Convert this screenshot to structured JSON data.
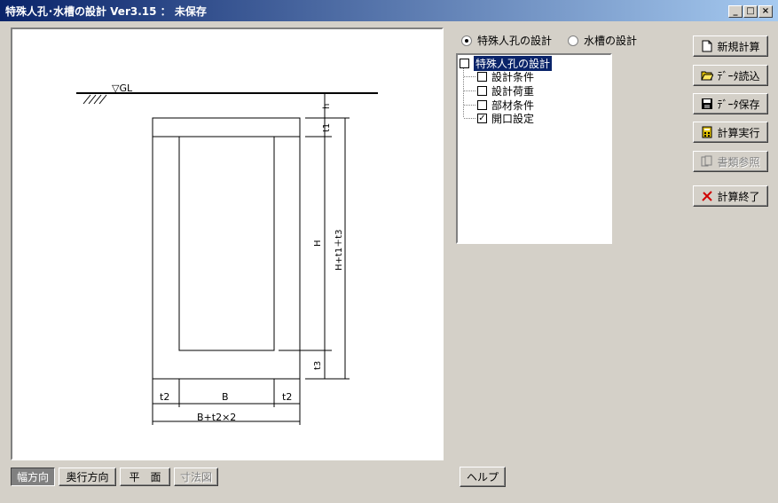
{
  "window": {
    "title": "特殊人孔･水槽の設計  Ver3.15  ： 未保存",
    "minimize": "_",
    "maximize": "□",
    "close": "×"
  },
  "mode": {
    "option1": "特殊人孔の設計",
    "option2": "水槽の設計",
    "selected": "option1"
  },
  "tree": {
    "root": "特殊人孔の設計",
    "items": [
      {
        "label": "設計条件",
        "checked": false
      },
      {
        "label": "設計荷重",
        "checked": false
      },
      {
        "label": "部材条件",
        "checked": false
      },
      {
        "label": "開口設定",
        "checked": true
      }
    ]
  },
  "side_buttons": {
    "new_calc": "新規計算",
    "load_data": "ﾃﾞｰﾀ読込",
    "save_data": "ﾃﾞｰﾀ保存",
    "run_calc": "計算実行",
    "view_docs": "書類参照",
    "exit_calc": "計算終了"
  },
  "view_tabs": {
    "width_dir": "幅方向",
    "depth_dir": "奥行方向",
    "plan": "平　面",
    "dim_drawing": "寸法図"
  },
  "help_button": "ヘルプ",
  "drawing": {
    "gl_label": "▽GL",
    "dim_h": "h",
    "dim_t1": "t1",
    "dim_H": "H",
    "dim_t3": "t3",
    "dim_total_h": "H+t1＋t3",
    "dim_t2_left": "t2",
    "dim_B": "B",
    "dim_t2_right": "t2",
    "dim_total_w": "B+t2×2"
  }
}
